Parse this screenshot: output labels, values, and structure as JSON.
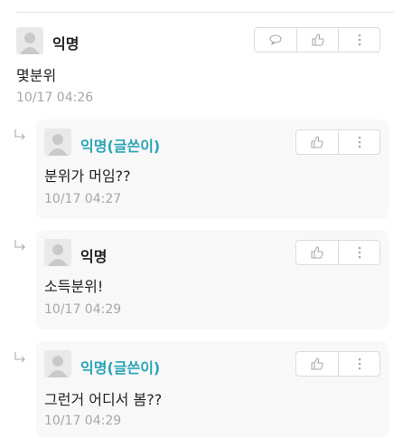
{
  "comment": {
    "author": "익명",
    "text": "몇분위",
    "time": "10/17 04:26",
    "buttons": [
      "comment-icon",
      "like-icon",
      "more-icon"
    ]
  },
  "replies": [
    {
      "author": "익명(글쓴이)",
      "is_op": true,
      "text": "분위가 머임??",
      "time": "10/17 04:27"
    },
    {
      "author": "익명",
      "is_op": false,
      "text": "소득분위!",
      "time": "10/17 04:29"
    },
    {
      "author": "익명(글쓴이)",
      "is_op": true,
      "text": "그런거 어디서 봄??",
      "time": "10/17 04:29"
    }
  ],
  "colors": {
    "op_name": "#2aa4b7",
    "time": "#a6a6a6",
    "reply_bg": "#f8f8f8"
  }
}
